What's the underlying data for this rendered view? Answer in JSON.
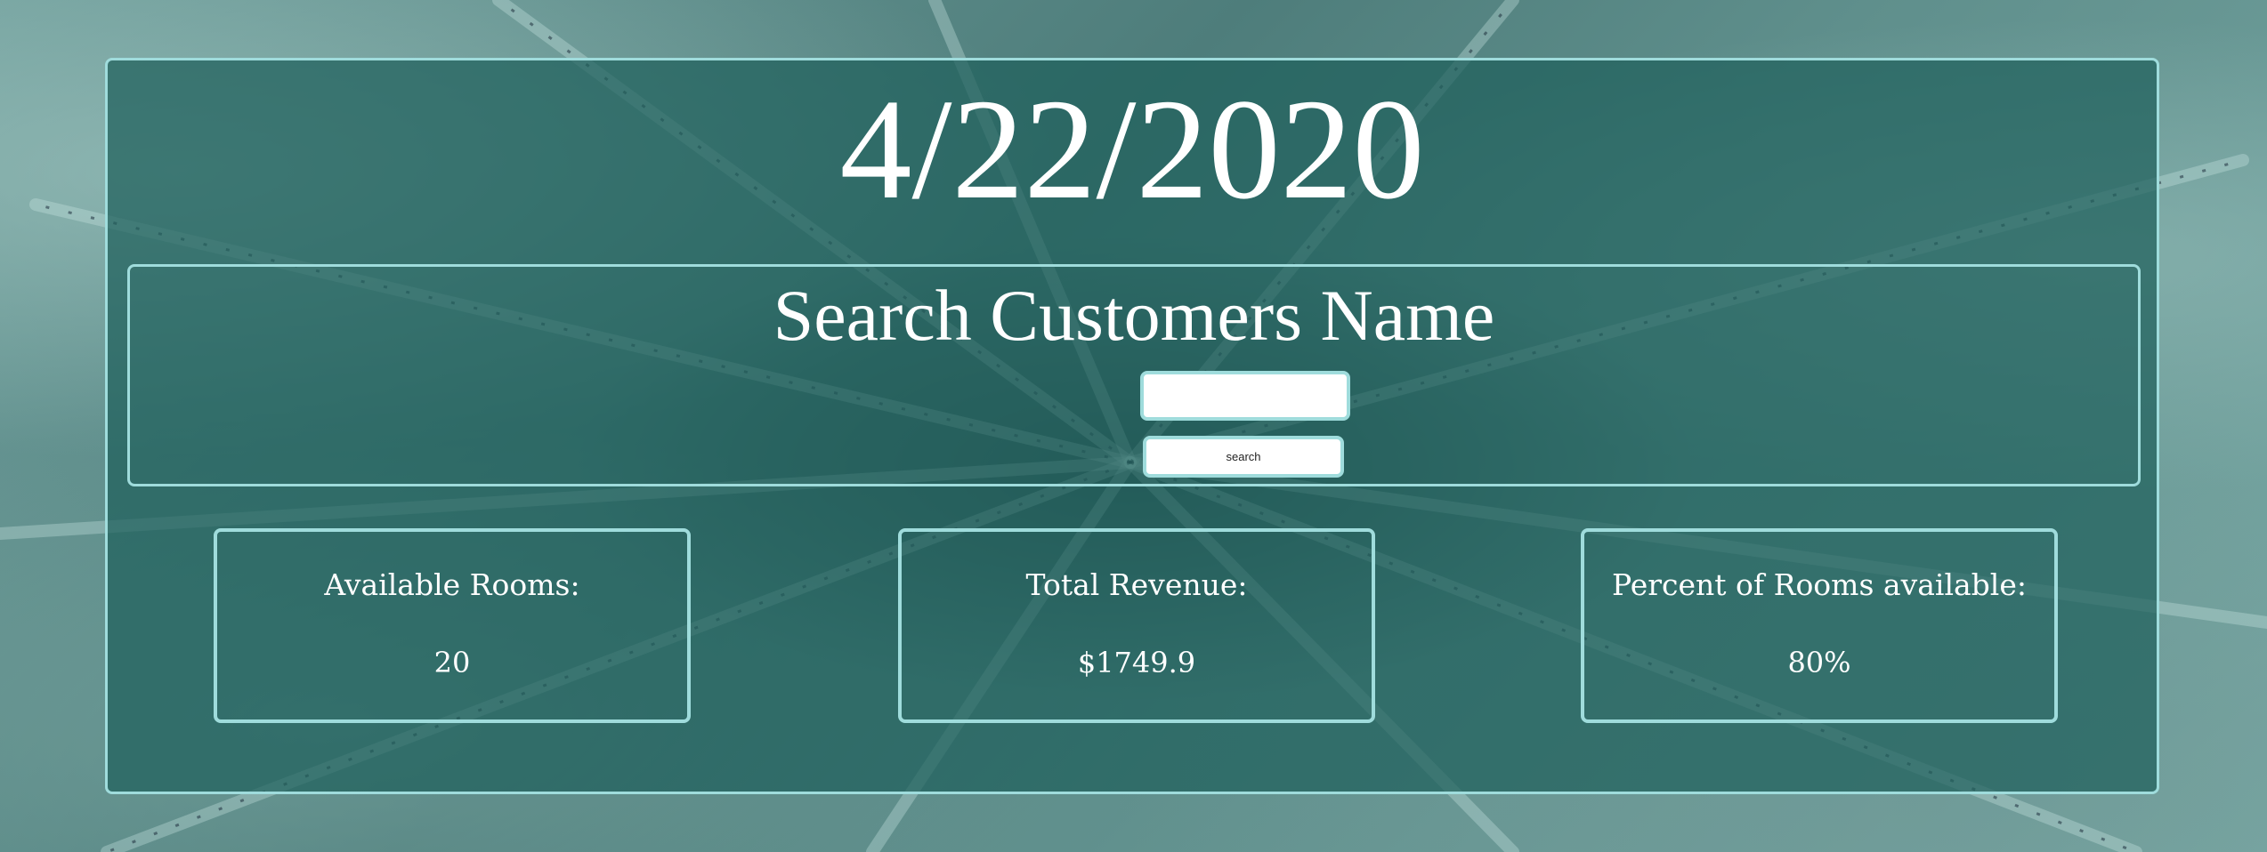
{
  "header": {
    "date": "4/22/2020"
  },
  "search": {
    "title": "Search Customers Name",
    "input_value": "",
    "input_placeholder": "",
    "button_label": "search"
  },
  "stats": [
    {
      "label": "Available Rooms:",
      "value": "20"
    },
    {
      "label": "Total Revenue:",
      "value": "$1749.9"
    },
    {
      "label": "Percent of Rooms available:",
      "value": "80%"
    }
  ],
  "colors": {
    "panel_border": "#9fdcdc",
    "panel_background": "#1e5f5c",
    "text": "#ffffff"
  }
}
